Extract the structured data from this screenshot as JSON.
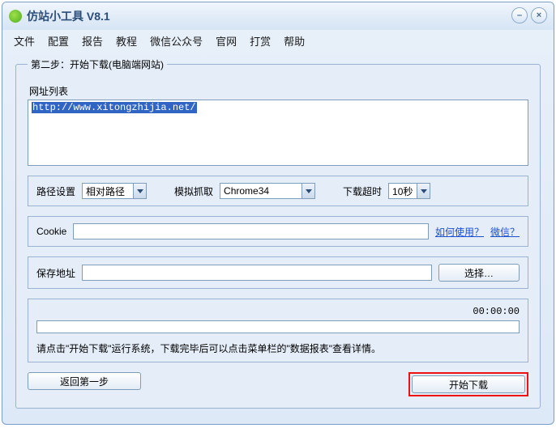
{
  "window": {
    "title": "仿站小工具 V8.1"
  },
  "menu": {
    "file": "文件",
    "config": "配置",
    "report": "报告",
    "tutorial": "教程",
    "wechat": "微信公众号",
    "website": "官网",
    "donate": "打赏",
    "help": "帮助"
  },
  "step": {
    "legend": "第二步：开始下载(电脑端网站)",
    "url_label": "网址列表",
    "url_value": "http://www.xitongzhijia.net/",
    "path_label": "路径设置",
    "path_value": "相对路径",
    "grab_label": "模拟抓取",
    "grab_value": "Chrome34",
    "timeout_label": "下载超时",
    "timeout_value": "10秒",
    "cookie_label": "Cookie",
    "cookie_value": "",
    "how_link": "如何使用？",
    "wechat_link": "微信？",
    "save_label": "保存地址",
    "save_value": "",
    "browse_btn": "选择…",
    "timer": "00:00:00",
    "hint": "请点击\"开始下载\"运行系统，下载完毕后可以点击菜单栏的\"数据报表\"查看详情。",
    "back_btn": "返回第一步",
    "start_btn": "开始下载"
  }
}
